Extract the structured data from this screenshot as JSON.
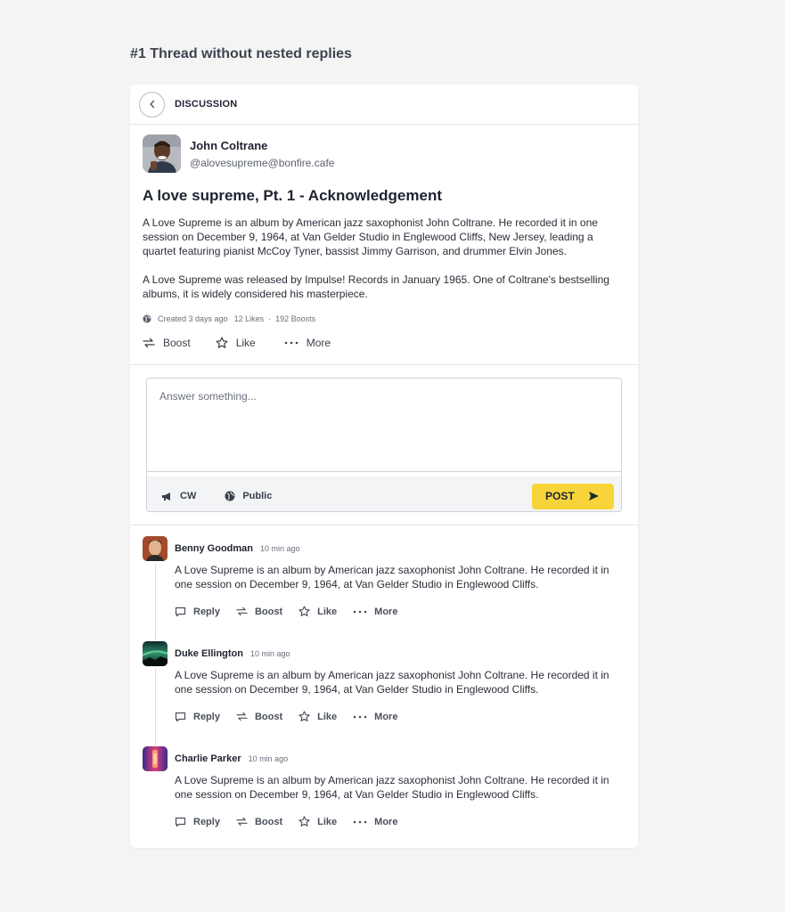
{
  "page": {
    "heading": "#1 Thread without nested replies"
  },
  "header": {
    "title": "DISCUSSION"
  },
  "post": {
    "author_name": "John Coltrane",
    "author_handle": "@alovesupreme@bonfire.cafe",
    "title": "A love supreme, Pt. 1 - Acknowledgement",
    "paragraphs": [
      "A Love Supreme is an album by American jazz saxophonist John Coltrane. He recorded it in one session on December 9, 1964, at Van Gelder Studio in Englewood Cliffs, New Jersey, leading a quartet featuring pianist McCoy Tyner, bassist Jimmy Garrison, and drummer Elvin Jones.",
      "A Love Supreme was released by Impulse! Records in January 1965. One of Coltrane's bestselling albums, it is widely considered his masterpiece."
    ],
    "created": "Created 3 days ago",
    "likes": "12 Likes",
    "separator": "·",
    "boosts": "192 Boosts",
    "actions": {
      "boost": "Boost",
      "like": "Like",
      "more": "More"
    }
  },
  "composer": {
    "placeholder": "Answer something...",
    "cw_label": "CW",
    "visibility_label": "Public",
    "post_label": "POST"
  },
  "replies": [
    {
      "name": "Benny Goodman",
      "time": "10 min ago",
      "body": "A Love Supreme is an album by American jazz saxophonist John Coltrane. He recorded it in one session on December 9, 1964, at Van Gelder Studio in Englewood Cliffs.",
      "actions": {
        "reply": "Reply",
        "boost": "Boost",
        "like": "Like",
        "more": "More"
      }
    },
    {
      "name": "Duke Ellington",
      "time": "10 min ago",
      "body": "A Love Supreme is an album by American jazz saxophonist John Coltrane. He recorded it in one session on December 9, 1964, at Van Gelder Studio in Englewood Cliffs.",
      "actions": {
        "reply": "Reply",
        "boost": "Boost",
        "like": "Like",
        "more": "More"
      }
    },
    {
      "name": "Charlie Parker",
      "time": "10 min ago",
      "body": "A Love Supreme is an album by American jazz saxophonist John Coltrane. He recorded it in one session on December 9, 1964, at Van Gelder Studio in Englewood Cliffs.",
      "actions": {
        "reply": "Reply",
        "boost": "Boost",
        "like": "Like",
        "more": "More"
      }
    }
  ],
  "colors": {
    "accent": "#f7d53a",
    "background": "#f4f4f4",
    "card": "#ffffff"
  },
  "icons": [
    "chevron-left-icon",
    "globe-icon",
    "boost-icon",
    "star-icon",
    "more-icon",
    "megaphone-icon",
    "send-icon",
    "comment-icon"
  ]
}
